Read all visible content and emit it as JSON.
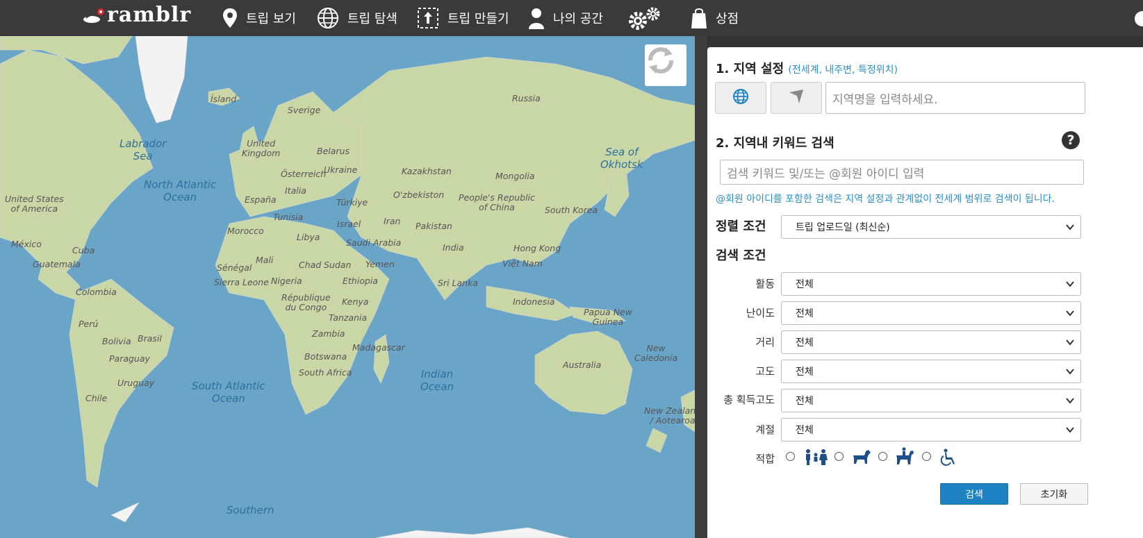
{
  "header": {
    "logo_text": "ramblr",
    "nav": [
      {
        "label": "트립 보기",
        "icon": "map-pin-icon"
      },
      {
        "label": "트립 탐색",
        "icon": "globe-icon"
      },
      {
        "label": "트립 만들기",
        "icon": "upload-icon"
      },
      {
        "label": "나의 공간",
        "icon": "user-icon"
      },
      {
        "label": "",
        "icon": "gears-icon"
      },
      {
        "label": "상점",
        "icon": "shopping-bag-icon"
      }
    ]
  },
  "map": {
    "refresh_icon": "refresh-icon",
    "labels": {
      "island": "Ísland",
      "sverige": "Sverige",
      "russia": "Russia",
      "uk": "United\nKingdom",
      "belarus": "Belarus",
      "osterreich": "Österreich",
      "ukraine": "Ukraine",
      "kazakhstan": "Kazakhstan",
      "mongolia": "Mongolia",
      "italia": "Italia",
      "espana": "España",
      "turkiye": "Türkiye",
      "ozbekiston": "O'zbekiston",
      "china": "People's Republic\nof China",
      "southkorea": "South Korea",
      "tunisia": "Tunisia",
      "israel": "Israel",
      "iran": "Iran",
      "pakistan": "Pakistan",
      "morocco": "Morocco",
      "libya": "Libya",
      "saudi": "Saudi Arabia",
      "india": "India",
      "hongkong": "Hong Kong",
      "usa": "United States\nof America",
      "mexico": "México",
      "cuba": "Cuba",
      "guatemala": "Guatemala",
      "mali": "Mali",
      "chad": "Chad",
      "sudan": "Sudan",
      "yemen": "Yemen",
      "vietnam": "Việt Nam",
      "senegal": "Sénégal",
      "sierra": "Sierra Leone",
      "nigeria": "Nigeria",
      "ethiopia": "Ethiopia",
      "srilanka": "Sri Lanka",
      "colombia": "Colombia",
      "congo": "République\ndu Congo",
      "kenya": "Kenya",
      "indonesia": "Indonesia",
      "png": "Papua New\nGuinea",
      "tanzania": "Tanzania",
      "peru": "Perú",
      "bolivia": "Bolivia",
      "brasil": "Brasil",
      "zambia": "Zambia",
      "madagascar": "Madagascar",
      "newcal": "New\nCaledonia",
      "paraguay": "Paraguay",
      "botswana": "Botswana",
      "australia": "Australia",
      "southafrica": "South Africa",
      "uruguay": "Uruguay",
      "chile": "Chile",
      "nz": "New Zealand\n/ Aotearoa"
    },
    "oceans": {
      "labrador": "Labrador\nSea",
      "north_atlantic": "North Atlantic\nOcean",
      "okhotsk": "Sea of\nOkhotsk",
      "south_atlantic": "South Atlantic\nOcean",
      "indian": "Indian\nOcean",
      "southern": "Southern"
    }
  },
  "panel": {
    "region": {
      "title": "1. 지역 설정",
      "hint": "(전세계, 내주변, 특정위치)",
      "world_button_icon": "globe-icon",
      "nearby_button_icon": "location-arrow-icon",
      "placeholder": "지역명을 입력하세요."
    },
    "keyword": {
      "title": "2. 지역내 키워드 검색",
      "help": "?",
      "placeholder": "검색 키워드 및/또는 @회원 아이디 입력",
      "note": "@회원 아이디를 포함한 검색은 지역 설정과 관계없이 전세계 범위로 검색이 됩니다."
    },
    "sort": {
      "label": "정렬 조건",
      "value": "트립 업로드일 (최신순)"
    },
    "filters_title": "검색 조건",
    "filters": [
      {
        "label": "활동",
        "value": "전체"
      },
      {
        "label": "난이도",
        "value": "전체"
      },
      {
        "label": "거리",
        "value": "전체"
      },
      {
        "label": "고도",
        "value": "전체"
      },
      {
        "label": "총 획득고도",
        "value": "전체"
      },
      {
        "label": "계절",
        "value": "전체"
      }
    ],
    "suitability": {
      "label": "적합",
      "options": [
        "family-icon",
        "dog-icon",
        "horse-riding-icon",
        "wheelchair-icon"
      ]
    },
    "search_button": "검색",
    "reset_button": "초기화"
  },
  "colors": {
    "ocean": "#6aa5c8",
    "land": "#c9d6a6",
    "accent": "#1f83c3",
    "topbar": "#3a3a3a"
  }
}
